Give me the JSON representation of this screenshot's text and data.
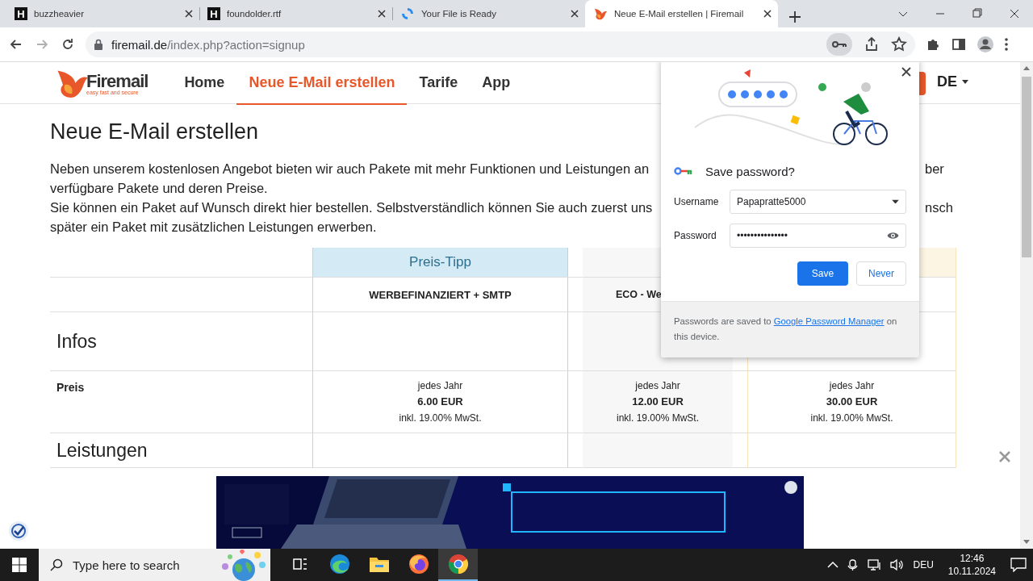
{
  "browser": {
    "tabs": [
      {
        "title": "buzzheavier",
        "kind": "letter",
        "icon_text": "H",
        "selected": false
      },
      {
        "title": "foundolder.rtf",
        "kind": "letter",
        "icon_text": "H",
        "selected": false
      },
      {
        "title": "Your File is Ready",
        "kind": "spinner",
        "selected": false
      },
      {
        "title": "Neue E-Mail erstellen | Firemail",
        "kind": "flame",
        "selected": true
      }
    ],
    "address": {
      "domain": "firemail.de",
      "path": "/index.php?action=signup"
    }
  },
  "site": {
    "logo": {
      "name": "Firemail",
      "tagline": "easy fast and secure"
    },
    "nav": [
      {
        "label": "Home",
        "selected": false
      },
      {
        "label": "Neue E-Mail erstellen",
        "selected": true
      },
      {
        "label": "Tarife",
        "selected": false
      },
      {
        "label": "App",
        "selected": false
      }
    ],
    "language": "DE",
    "heading": "Neue E-Mail erstellen",
    "intro_lines": [
      {
        "left": "Neben unserem kostenlosen Angebot bieten wir auch Pakete mit mehr Funktionen und Leistungen an",
        "right": "ber"
      },
      {
        "left": "verfügbare Pakete und deren Preise."
      },
      {
        "left": "Sie können ein Paket auf Wunsch direkt hier bestellen. Selbstverständlich können Sie auch zuerst uns",
        "right": "nsch"
      },
      {
        "left": "später ein Paket mit zusätzlichen Leistungen erwerben."
      }
    ],
    "table": {
      "columns": [
        {
          "kind": "tip",
          "banner": "Preis-Tipp",
          "name": "WERBEFINANZIERT + SMTP"
        },
        {
          "kind": "grey",
          "name": "ECO - We"
        },
        {
          "kind": "gold"
        }
      ],
      "rows": [
        {
          "kind": "section",
          "label": "Infos"
        },
        {
          "kind": "price",
          "label": "Preis",
          "cells": [
            {
              "period": "jedes Jahr",
              "price": "6.00 EUR",
              "tax": "inkl. 19.00% MwSt."
            },
            {
              "period": "jedes Jahr",
              "price": "12.00 EUR",
              "tax": "inkl. 19.00% MwSt."
            },
            {
              "period": "jedes Jahr",
              "price": "30.00 EUR",
              "tax": "inkl. 19.00% MwSt."
            }
          ]
        },
        {
          "kind": "section",
          "label": "Leistungen"
        }
      ]
    }
  },
  "password_popup": {
    "title": "Save password?",
    "username_label": "Username",
    "username": "Papapratte5000",
    "password_label": "Password",
    "password": "•••••••••••••••",
    "buttons": [
      {
        "label": "Save",
        "kind": "primary"
      },
      {
        "label": "Never",
        "kind": "secondary"
      }
    ],
    "footer": {
      "before": "Passwords are saved to ",
      "link": "Google Password Manager",
      "after": " on this device."
    }
  },
  "taskbar": {
    "search_placeholder": "Type here to search",
    "apps": [
      {
        "kind": "taskview",
        "selected": false
      },
      {
        "kind": "edge",
        "selected": false
      },
      {
        "kind": "folder",
        "selected": false
      },
      {
        "kind": "firefox",
        "selected": false
      },
      {
        "kind": "chrome",
        "selected": true
      }
    ],
    "language": "DEU",
    "time": "12:46",
    "date": "10.11.2024"
  }
}
